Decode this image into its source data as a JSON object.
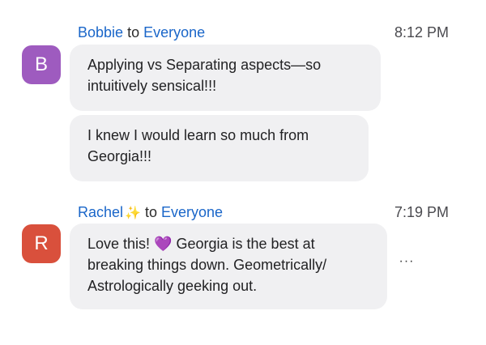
{
  "messages": [
    {
      "sender": "Bobbie",
      "to_word": "to",
      "recipient": "Everyone",
      "time": "8:12 PM",
      "avatar_letter": "B",
      "avatar_color": "#9e5bbf",
      "bubbles": [
        "Applying vs Separating aspects—so intuitively sensical!!!",
        "I knew I would learn so much from Georgia!!!"
      ]
    },
    {
      "sender": "Rachel",
      "sender_emoji": "✨",
      "to_word": "to",
      "recipient": "Everyone",
      "time": "7:19 PM",
      "avatar_letter": "R",
      "avatar_color": "#d9503c",
      "bubble_part1": "Love this!",
      "bubble_emoji": "💜",
      "bubble_part2": "Georgia is the best at breaking things down. Geometrically/ Astrologically geeking out.",
      "more_icon": "more-horizontal-icon",
      "more_label": "···"
    }
  ]
}
